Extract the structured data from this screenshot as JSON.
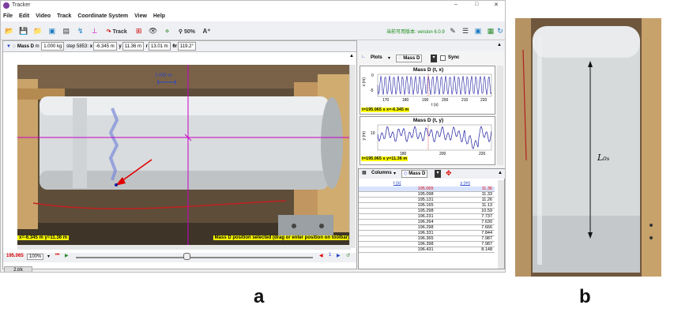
{
  "window": {
    "title": "Tracker"
  },
  "menu": [
    "File",
    "Edit",
    "Video",
    "Track",
    "Coordinate System",
    "View",
    "Help"
  ],
  "toolbar": {
    "track_label": "Track",
    "zoom": "50%",
    "font_size": "A⁺",
    "version_note": "当前可用版本: version 6.0.9"
  },
  "pointbar": {
    "track_name": "Mass D",
    "mass_label": "m",
    "mass": "1.000 kg",
    "step": "step 5853:",
    "x_label": "x",
    "x": "-6.345 m",
    "y_label": "y",
    "y": "11.36 m",
    "r_label": "r",
    "r": "13.01 m",
    "theta_label": "θr",
    "theta": "119.2°"
  },
  "video": {
    "scale_label": "2.000 m",
    "coords": "x=-6.345 m  y=11.36 m",
    "hint": "Mass D position selected (drag or enter position on toolbar)"
  },
  "player": {
    "time": "195.065",
    "zoom": "100%"
  },
  "plots": {
    "menu": "Plots",
    "track": "Mass D",
    "sync": "Sync",
    "plot1": {
      "title": "Mass D (t, x)",
      "ylabel": "x (m)",
      "xlabel": "t (s)",
      "yticks": [
        "0",
        "-5"
      ],
      "xticks": [
        "170",
        "180",
        "190",
        "200",
        "210",
        "220"
      ],
      "readout": "t=195.065 s  x=-6.345 m"
    },
    "plot2": {
      "title": "Mass D (t, y)",
      "ylabel": "y (m)",
      "yticks": [
        "10"
      ],
      "xticks": [
        "180",
        "200",
        "220"
      ],
      "readout": "t=195.065 s  y=11.36 m"
    }
  },
  "table": {
    "columns_label": "Columns",
    "track": "Mass D",
    "headers": [
      "t (s)",
      "y (m)"
    ],
    "rows": [
      [
        "195.065",
        "11.36"
      ],
      [
        "195.098",
        "11.33"
      ],
      [
        "195.131",
        "11.26"
      ],
      [
        "195.165",
        "11.13"
      ],
      [
        "195.298",
        "10.59"
      ],
      [
        "196.231",
        "7.737"
      ],
      [
        "196.264",
        "7.630"
      ],
      [
        "196.298",
        "7.666"
      ],
      [
        "196.331",
        "7.844"
      ],
      [
        "196.365",
        "7.987"
      ],
      [
        "196.398",
        "7.987"
      ],
      [
        "196.431",
        "8.148"
      ]
    ]
  },
  "file_tab": "2.trk",
  "labels": {
    "a": "a",
    "b": "b",
    "photo_annotation": "L₀ₛ"
  },
  "colors": {
    "accent": "#c800c8",
    "highlight": "#ffff00",
    "selected_row": "#d8e4ff",
    "plot_line": "#1a1aa0"
  }
}
